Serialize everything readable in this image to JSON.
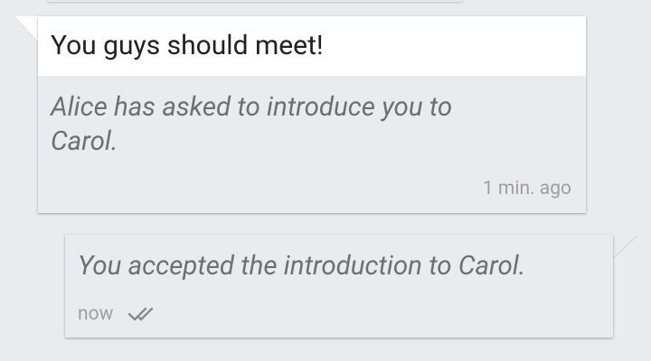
{
  "messages": [
    {
      "direction": "incoming",
      "title": "You guys should meet!",
      "body": "Alice has asked to introduce you to Carol.",
      "time": "1 min. ago"
    },
    {
      "direction": "outgoing",
      "body": "You accepted the introduction to Carol.",
      "time": "now",
      "status_icon": "double-check-icon"
    }
  ],
  "colors": {
    "background": "#e9ecef",
    "header_bg": "#ffffff",
    "title_text": "#212121",
    "body_text": "#6f6f6f",
    "meta_text": "#9e9e9e"
  }
}
